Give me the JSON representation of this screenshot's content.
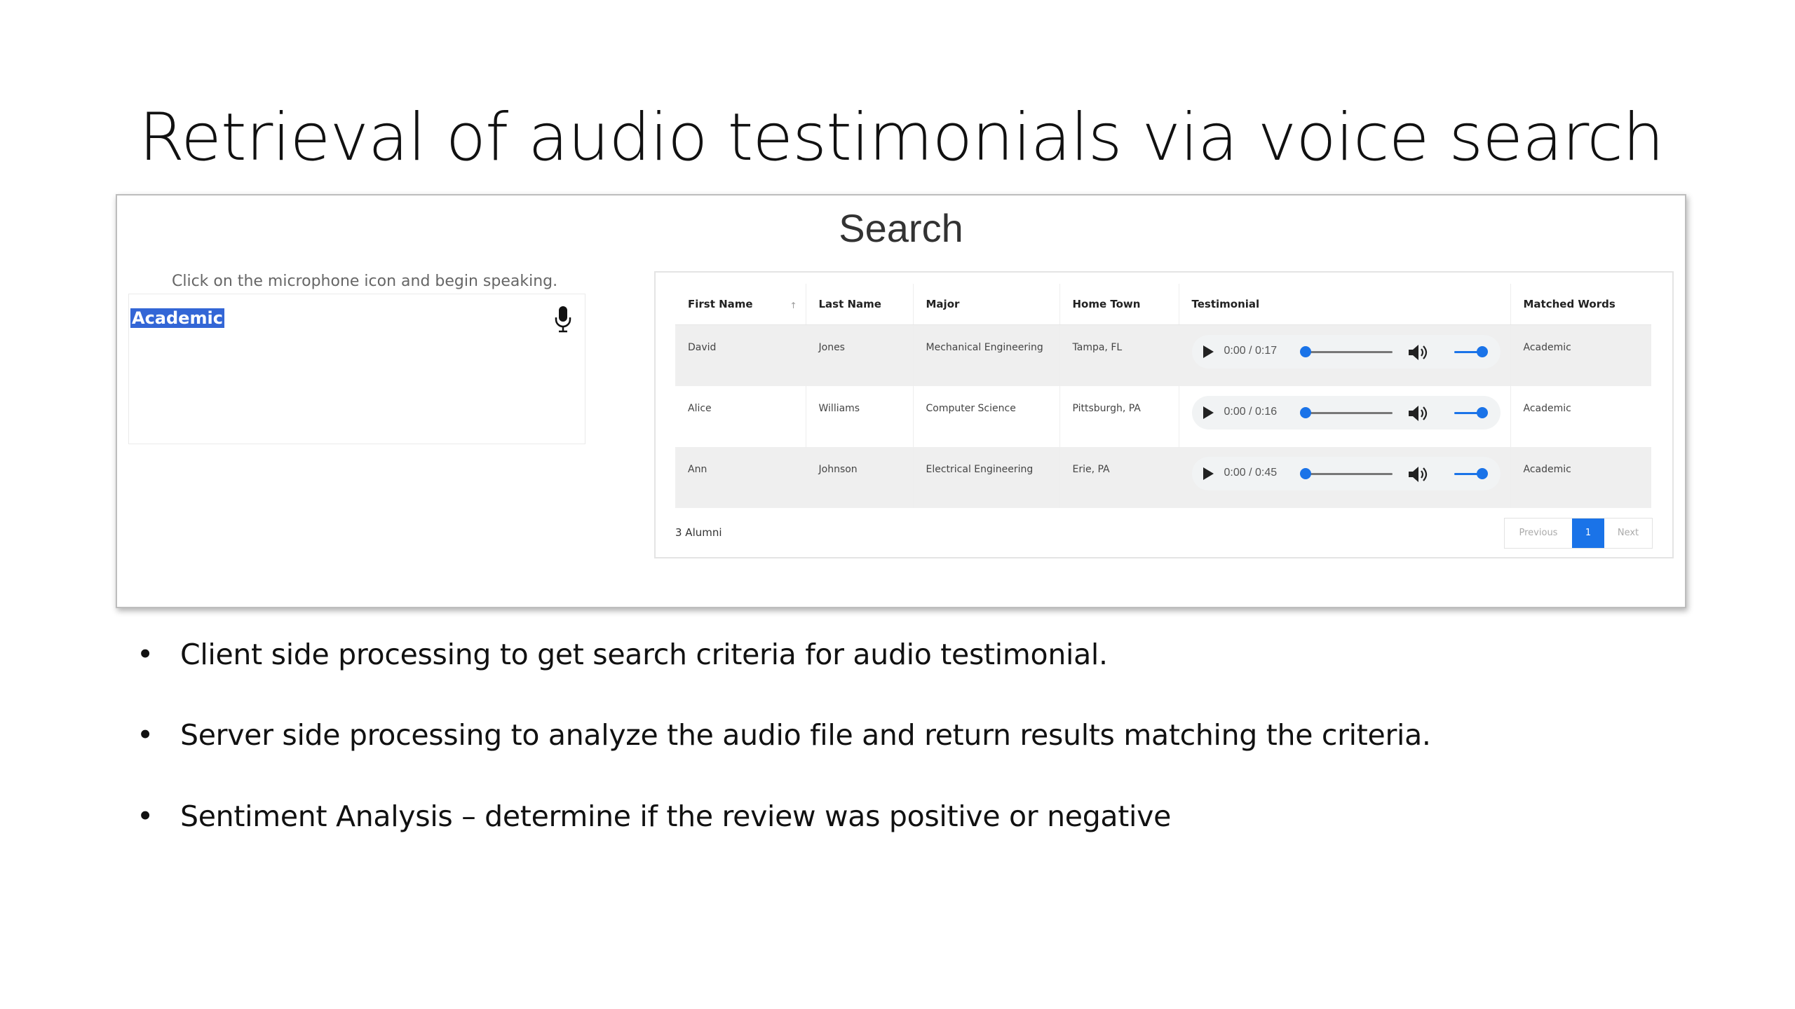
{
  "slide": {
    "title": "Retrieval of audio testimonials via voice search",
    "bullets": [
      "Client side processing to get search criteria for audio testimonial.",
      "Server side processing to analyze the audio file and return results matching the criteria.",
      "Sentiment Analysis – determine if the review was positive or negative"
    ]
  },
  "app": {
    "heading": "Search",
    "voice": {
      "hint": "Click on the microphone icon and begin speaking.",
      "recognized_text": "Academic",
      "mic_icon": "microphone-icon"
    },
    "table": {
      "columns": [
        "First Name",
        "Last Name",
        "Major",
        "Home Town",
        "Testimonial",
        "Matched Words"
      ],
      "rows": [
        {
          "first": "David",
          "last": "Jones",
          "major": "Mechanical Engineering",
          "town": "Tampa, FL",
          "time": "0:00 / 0:17",
          "matched": "Academic"
        },
        {
          "first": "Alice",
          "last": "Williams",
          "major": "Computer Science",
          "town": "Pittsburgh, PA",
          "time": "0:00 / 0:16",
          "matched": "Academic"
        },
        {
          "first": "Ann",
          "last": "Johnson",
          "major": "Electrical Engineering",
          "town": "Erie, PA",
          "time": "0:00 / 0:45",
          "matched": "Academic"
        }
      ],
      "info": "3 Alumni",
      "pagination": {
        "previous": "Previous",
        "current": "1",
        "next": "Next"
      }
    },
    "player_icons": [
      "play-icon",
      "volume-icon"
    ],
    "colors": {
      "accent": "#1a73e8",
      "selection": "#3366d6",
      "row_stripe": "#efefef"
    }
  }
}
